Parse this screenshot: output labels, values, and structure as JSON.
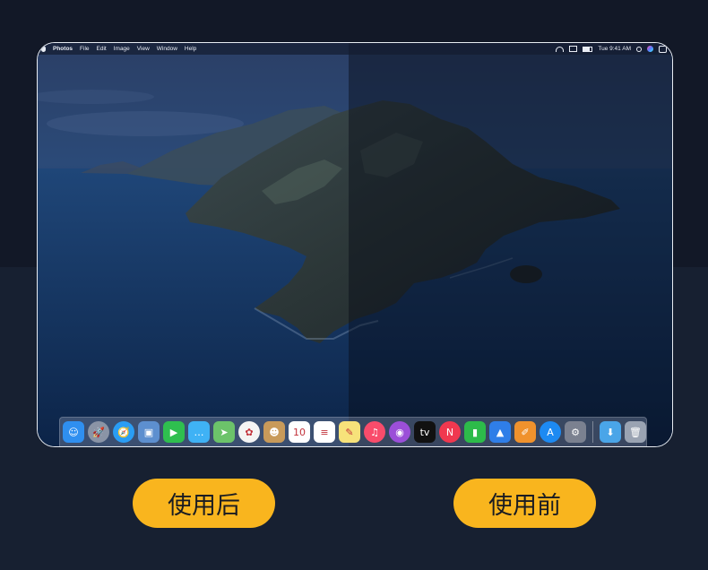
{
  "menubar": {
    "app_name": "Photos",
    "menus": [
      "File",
      "Edit",
      "Image",
      "View",
      "Window",
      "Help"
    ],
    "clock": "Tue 9:41 AM"
  },
  "dock": {
    "apps": [
      {
        "name": "finder-icon",
        "glyph": "☺",
        "color": "#2f8ff0"
      },
      {
        "name": "launchpad-icon",
        "glyph": "🚀",
        "color": "#8a94a6"
      },
      {
        "name": "safari-icon",
        "glyph": "🧭",
        "color": "#2a9df4"
      },
      {
        "name": "preview-icon",
        "glyph": "▣",
        "color": "#5d8fcf"
      },
      {
        "name": "facetime-icon",
        "glyph": "▶",
        "color": "#2fbf4f"
      },
      {
        "name": "messages-icon",
        "glyph": "…",
        "color": "#3fb2f5"
      },
      {
        "name": "maps-icon",
        "glyph": "➤",
        "color": "#6cc36a"
      },
      {
        "name": "photos-icon",
        "glyph": "✿",
        "color": "#f4f4f4"
      },
      {
        "name": "contacts-icon",
        "glyph": "☻",
        "color": "#c89a5a"
      },
      {
        "name": "calendar-icon",
        "glyph": "10",
        "color": "#ffffff"
      },
      {
        "name": "reminders-icon",
        "glyph": "≡",
        "color": "#ffffff"
      },
      {
        "name": "notes-icon",
        "glyph": "✎",
        "color": "#f7e27a"
      },
      {
        "name": "music-icon",
        "glyph": "♫",
        "color": "#f94c6b"
      },
      {
        "name": "podcasts-icon",
        "glyph": "◉",
        "color": "#9b4fd8"
      },
      {
        "name": "tv-icon",
        "glyph": "tv",
        "color": "#111111"
      },
      {
        "name": "news-icon",
        "glyph": "N",
        "color": "#f0384f"
      },
      {
        "name": "numbers-icon",
        "glyph": "▮",
        "color": "#2dbb4a"
      },
      {
        "name": "keynote-icon",
        "glyph": "▲",
        "color": "#2f7ee8"
      },
      {
        "name": "pages-icon",
        "glyph": "✐",
        "color": "#f0922d"
      },
      {
        "name": "app-store-icon",
        "glyph": "A",
        "color": "#1d8af2"
      },
      {
        "name": "system-preferences-icon",
        "glyph": "⚙",
        "color": "#7b8190"
      }
    ],
    "extras": [
      {
        "name": "downloads-folder-icon",
        "glyph": "⬇",
        "color": "#4aa5e8"
      },
      {
        "name": "trash-icon",
        "glyph": "🗑",
        "color": "#9aa3b2"
      }
    ]
  },
  "buttons": {
    "after_label": "使用后",
    "before_label": "使用前"
  }
}
